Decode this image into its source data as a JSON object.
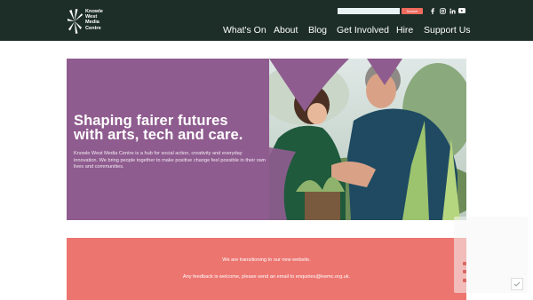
{
  "header": {
    "logo_lines": [
      "Knowle",
      "West",
      "Media",
      "Centre"
    ],
    "search_button": "Search",
    "social_icons": [
      "facebook-icon",
      "instagram-icon",
      "linkedin-icon",
      "youtube-icon"
    ],
    "nav": [
      {
        "label": "What's On"
      },
      {
        "label": "About"
      },
      {
        "label": "Blog"
      },
      {
        "label": "Get Involved"
      },
      {
        "label": "Hire"
      },
      {
        "label": "Support Us"
      }
    ]
  },
  "hero": {
    "title_line1": "Shaping fairer futures",
    "title_line2": "with arts, tech and care.",
    "description": "Knowle West Media Centre is a hub for social action, creativity and everyday innovation. We bring people together to make positive change feel possible in their own lives and communities."
  },
  "banner": {
    "line1": "We are transitioning to our new website.",
    "line2": "Any feedback is welcome, please send an email to enquiries@kwmc.org.uk."
  },
  "colors": {
    "header_bg": "#1d2e28",
    "hero_purple": "#8f5c8f",
    "banner_coral": "#ec7570",
    "search_button": "#ef6b5e"
  }
}
